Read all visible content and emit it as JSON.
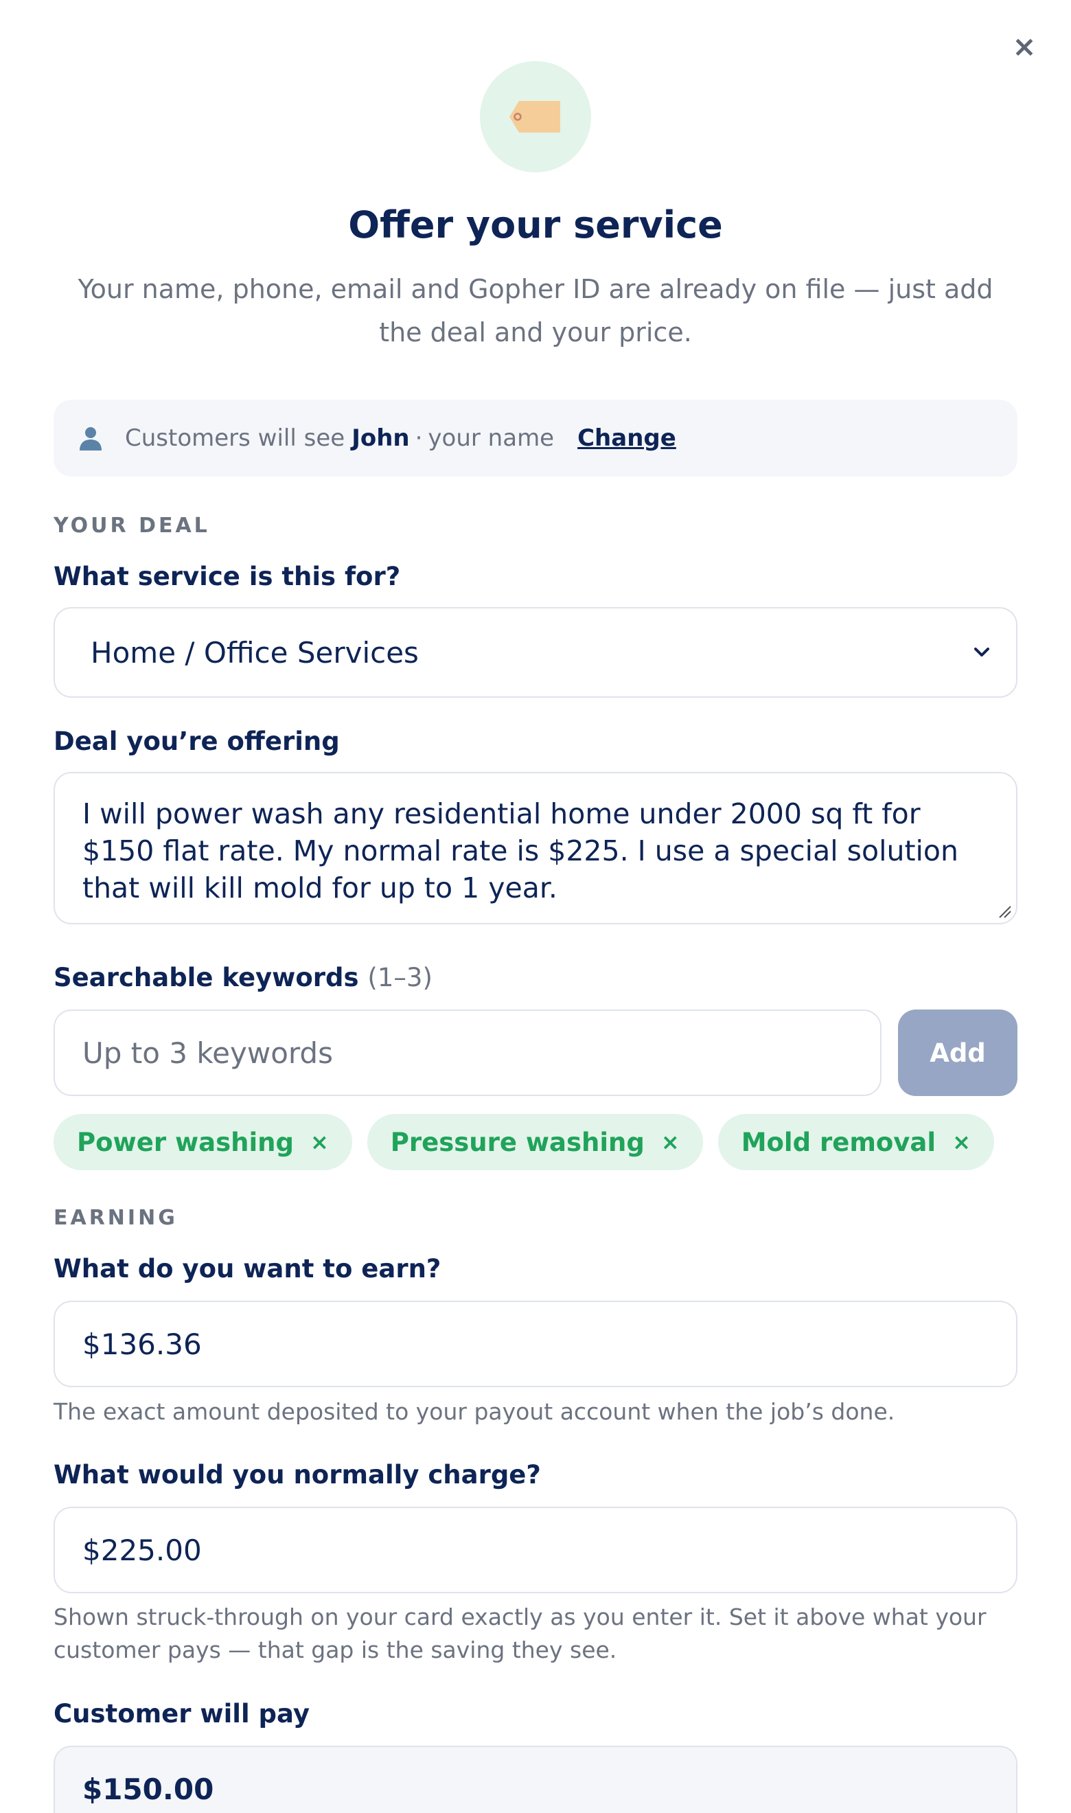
{
  "modal": {
    "close_label": "×",
    "title": "Offer your service",
    "subtitle": "Your name, phone, email and Gopher ID are already on file — just add the deal and your price."
  },
  "identity": {
    "prefix": "Customers will see",
    "name": "John",
    "separator": "·",
    "suffix": "your name",
    "change_label": "Change"
  },
  "deal_section": {
    "heading": "YOUR DEAL",
    "service_label": "What service is this for?",
    "service_value": "Home / Office Services",
    "offer_label": "Deal you’re offering",
    "offer_text": "I will power wash any residential home under 2000 sq ft for $150 flat rate. My normal rate is $225. I use a special solution that will kill mold for up to 1 year.",
    "keywords_label": "Searchable keywords",
    "keywords_hint": "(1–3)",
    "keywords_placeholder": "Up to 3 keywords",
    "add_label": "Add",
    "keywords": [
      {
        "label": "Power washing",
        "remove": "×"
      },
      {
        "label": "Pressure washing",
        "remove": "×"
      },
      {
        "label": "Mold removal",
        "remove": "×"
      }
    ]
  },
  "earning_section": {
    "heading": "EARNING",
    "earn_label": "What do you want to earn?",
    "earn_value": "$136.36",
    "earn_help": "The exact amount deposited to your payout account when the job’s done.",
    "normal_label": "What would you normally charge?",
    "normal_value": "$225.00",
    "normal_help": "Shown struck-through on your card exactly as you enter it. Set it above what your customer pays — that gap is the saving they see.",
    "pay_label": "Customer will pay",
    "pay_value": "$150.00"
  },
  "colors": {
    "navy": "#0e2456",
    "muted": "#6b7280",
    "green": "#20a35a",
    "chip_bg": "#e3f4ea",
    "button_disabled": "#97a6c4",
    "tag": "#f5cd98"
  },
  "icons": [
    "close-icon",
    "price-tag-icon",
    "person-icon",
    "chevron-down-icon",
    "resize-grip-icon"
  ]
}
